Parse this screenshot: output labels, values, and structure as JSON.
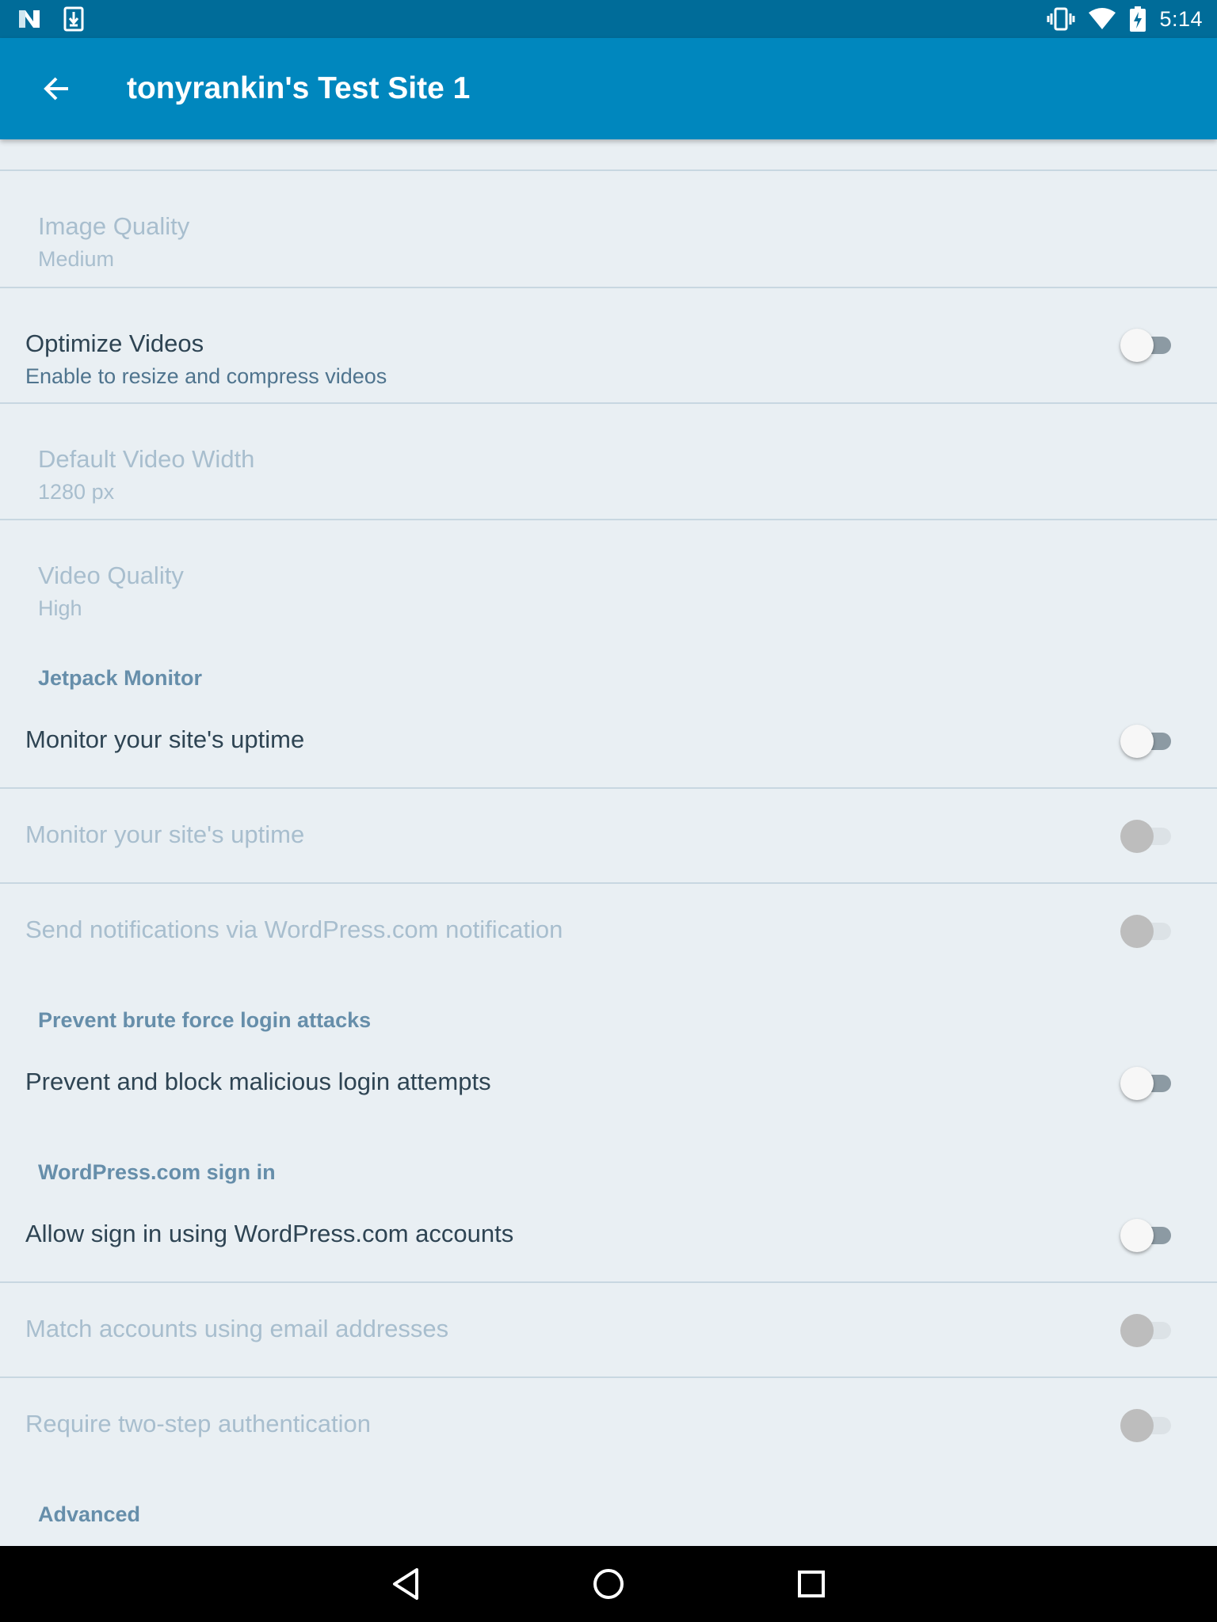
{
  "status_bar": {
    "time": "5:14",
    "left_icons": [
      "n-notification-icon",
      "download-icon"
    ],
    "right_icons": [
      "vibrate-icon",
      "wifi-icon",
      "battery-charging-icon"
    ]
  },
  "app_bar": {
    "back_icon": "arrow-back-icon",
    "title": "tonyrankin's Test Site 1",
    "color": "#0087be"
  },
  "settings": {
    "image_quality": {
      "title": "Image Quality",
      "summary": "Medium"
    },
    "optimize_videos": {
      "title": "Optimize Videos",
      "summary": "Enable to resize and compress videos",
      "checked": false
    },
    "default_video_width": {
      "title": "Default Video Width",
      "summary": "1280 px"
    },
    "video_quality": {
      "title": "Video Quality",
      "summary": "High"
    },
    "jetpack_monitor": {
      "header": "Jetpack Monitor",
      "monitor_uptime": {
        "title": "Monitor your site's uptime",
        "checked": false
      },
      "monitor_uptime_email": {
        "title": "Monitor your site's uptime",
        "checked": false,
        "enabled": false
      },
      "send_notifications": {
        "title": "Send notifications via WordPress.com notification",
        "checked": false,
        "enabled": false
      }
    },
    "brute_force": {
      "header": "Prevent brute force login attacks",
      "prevent_block": {
        "title": "Prevent and block malicious login attempts",
        "checked": false
      }
    },
    "wpcom_sign_in": {
      "header": "WordPress.com sign in",
      "allow_sign_in": {
        "title": "Allow sign in using WordPress.com accounts",
        "checked": false
      },
      "match_accounts": {
        "title": "Match accounts using email addresses",
        "checked": false,
        "enabled": false
      },
      "require_two_step": {
        "title": "Require two-step authentication",
        "checked": false,
        "enabled": false
      }
    },
    "advanced_header": "Advanced"
  },
  "nav_bar": {
    "icons": [
      "back-triangle-icon",
      "home-circle-icon",
      "recents-square-icon"
    ]
  }
}
